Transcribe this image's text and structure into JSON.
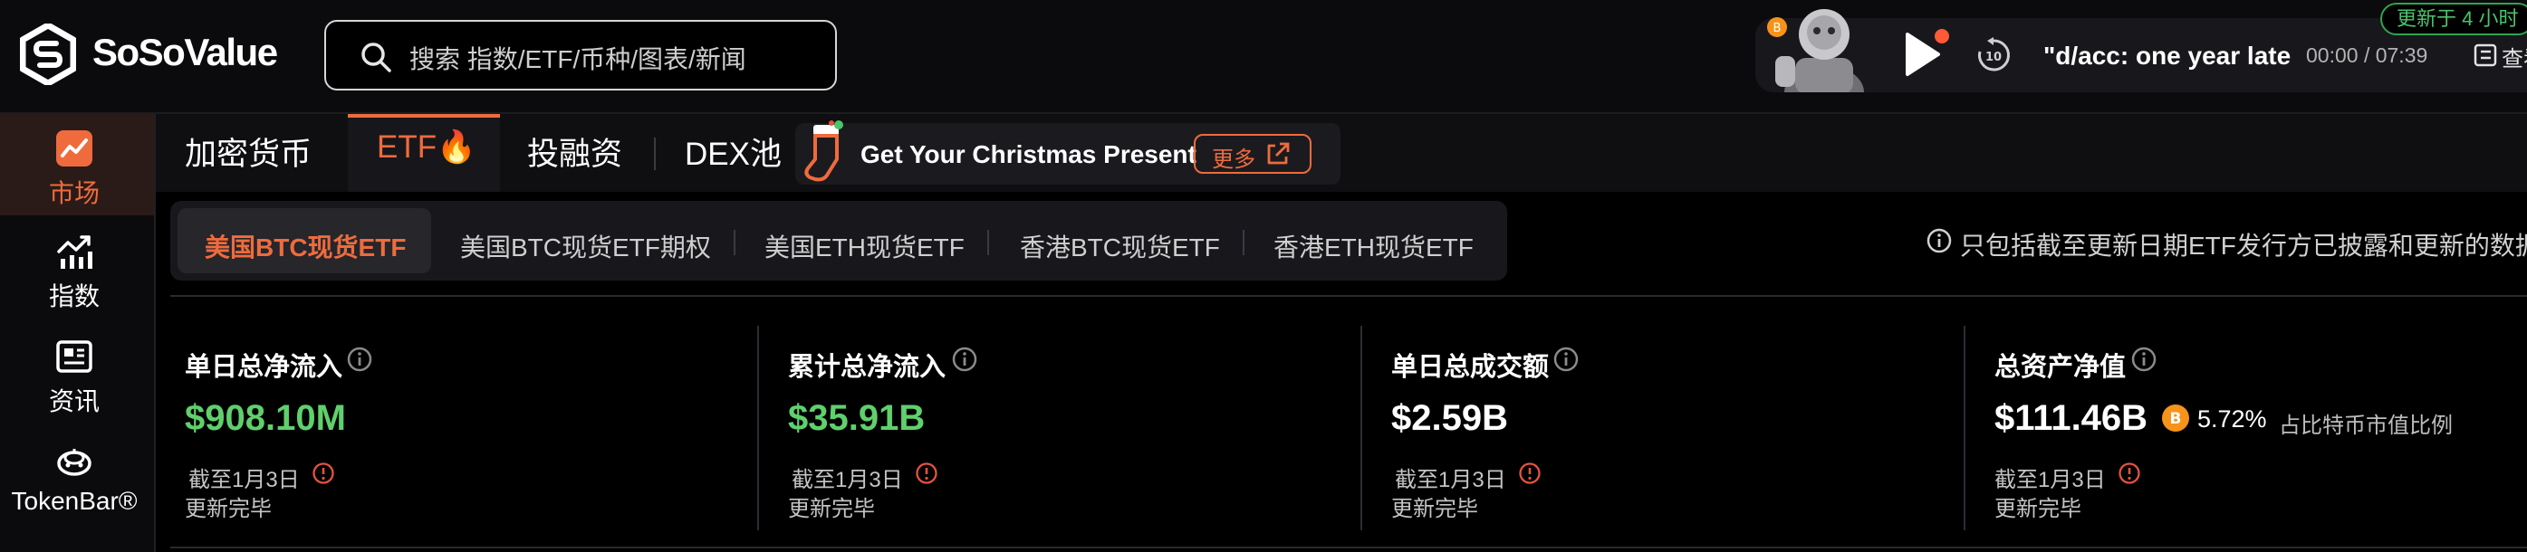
{
  "brand": {
    "name": "SoSoValue"
  },
  "search": {
    "placeholder": "搜索 指数/ETF/币种/图表/新闻"
  },
  "player": {
    "title": "\"d/acc: one year late",
    "time": "00:00 / 07:39",
    "update_badge": "更新于 4 小时",
    "view_label": "查看"
  },
  "sidebar": {
    "items": [
      {
        "label": "市场",
        "icon": "chart-trend-icon",
        "active": true
      },
      {
        "label": "指数",
        "icon": "index-chart-icon",
        "active": false
      },
      {
        "label": "资讯",
        "icon": "news-icon",
        "active": false
      },
      {
        "label": "TokenBar®",
        "icon": "tokenbar-icon",
        "active": false
      }
    ]
  },
  "main_nav": {
    "tabs": [
      {
        "label": "加密货币",
        "active": false
      },
      {
        "label": "ETF🔥",
        "active": true
      },
      {
        "label": "投融资",
        "active": false
      },
      {
        "label": "DEX池",
        "active": false
      }
    ],
    "promo": {
      "text": "Get Your Christmas Present",
      "button": "更多",
      "icon": "christmas-stocking-icon"
    }
  },
  "sub_tabs": [
    {
      "label": "美国BTC现货ETF",
      "active": true
    },
    {
      "label": "美国BTC现货ETF期权",
      "active": false
    },
    {
      "label": "美国ETH现货ETF",
      "active": false
    },
    {
      "label": "香港BTC现货ETF",
      "active": false
    },
    {
      "label": "香港ETH现货ETF",
      "active": false
    }
  ],
  "note": "只包括截至更新日期ETF发行方已披露和更新的数据",
  "cards": [
    {
      "title": "单日总净流入",
      "value": "$908.10M",
      "date": "截至1月3日",
      "status": "更新完毕"
    },
    {
      "title": "累计总净流入",
      "value": "$35.91B",
      "date": "截至1月3日",
      "status": "更新完毕"
    },
    {
      "title": "单日总成交额",
      "value": "$2.59B",
      "date": "截至1月3日",
      "status": "更新完毕"
    },
    {
      "title": "总资产净值",
      "value": "$111.46B",
      "date": "截至1月3日",
      "status": "更新完毕",
      "ratio": "5.72%",
      "ratio_label": "占比特币市值比例"
    }
  ],
  "colors": {
    "accent": "#ef6b3d",
    "positive": "#5fd06c",
    "badge_green": "#48c46a",
    "background": "#000000",
    "panel": "#18181c",
    "btc": "#f7931a",
    "warning": "#e5533d"
  }
}
